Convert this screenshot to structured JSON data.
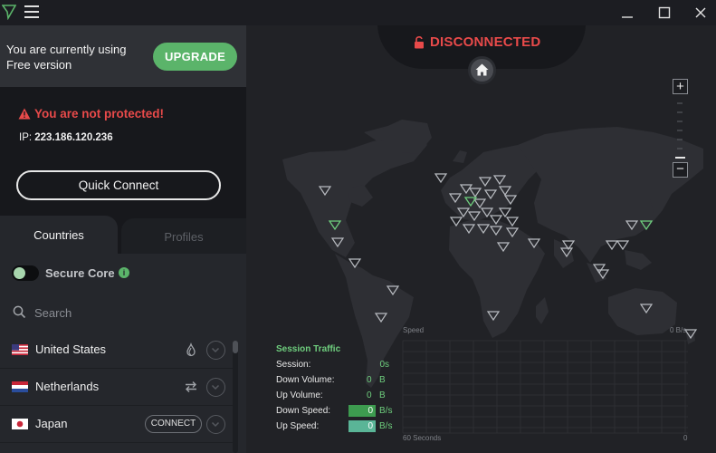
{
  "app": {
    "menu_icon": "hamburger-menu-icon",
    "logo_icon": "protonvpn-logo-icon",
    "window_controls": [
      "minimize-icon",
      "maximize-icon",
      "close-icon"
    ]
  },
  "plan": {
    "text": "You are currently using Free version",
    "upgrade_label": "UPGRADE"
  },
  "status": {
    "warning": "You are not protected!",
    "ip_label": "IP:",
    "ip_value": "223.186.120.236",
    "quick_connect_label": "Quick Connect"
  },
  "tabs": [
    {
      "label": "Countries",
      "active": true
    },
    {
      "label": "Profiles",
      "active": false
    }
  ],
  "secure_core": {
    "label": "Secure Core",
    "enabled": false
  },
  "search": {
    "placeholder": "Search"
  },
  "countries": [
    {
      "name": "United States",
      "feature_icon": "tor-onion-icon",
      "connect_label": ""
    },
    {
      "name": "Netherlands",
      "feature_icon": "p2p-arrows-icon",
      "connect_label": ""
    },
    {
      "name": "Japan",
      "feature_icon": "",
      "connect_label": "CONNECT"
    }
  ],
  "connection": {
    "status": "DISCONNECTED",
    "status_color": "#e84a4a"
  },
  "zoom": {
    "in_label": "+",
    "out_label": "−"
  },
  "traffic": {
    "title": "Session Traffic",
    "session_label": "Session:",
    "session_value": "0s",
    "down_volume_label": "Down Volume:",
    "down_volume_value": "0",
    "down_volume_unit": "B",
    "up_volume_label": "Up Volume:",
    "up_volume_value": "0",
    "up_volume_unit": "B",
    "down_speed_label": "Down Speed:",
    "down_speed_value": "0",
    "down_speed_unit": "B/s",
    "up_speed_label": "Up Speed:",
    "up_speed_value": "0",
    "up_speed_unit": "B/s"
  },
  "graph": {
    "title": "Speed",
    "y_max_label": "0 B/s",
    "x_start_label": "60 Seconds",
    "x_end_label": "0"
  },
  "colors": {
    "accent_green": "#5bb46a",
    "danger_red": "#e84a4a",
    "down_speed_color": "#3d9b4f",
    "up_speed_color": "#5ab597"
  }
}
